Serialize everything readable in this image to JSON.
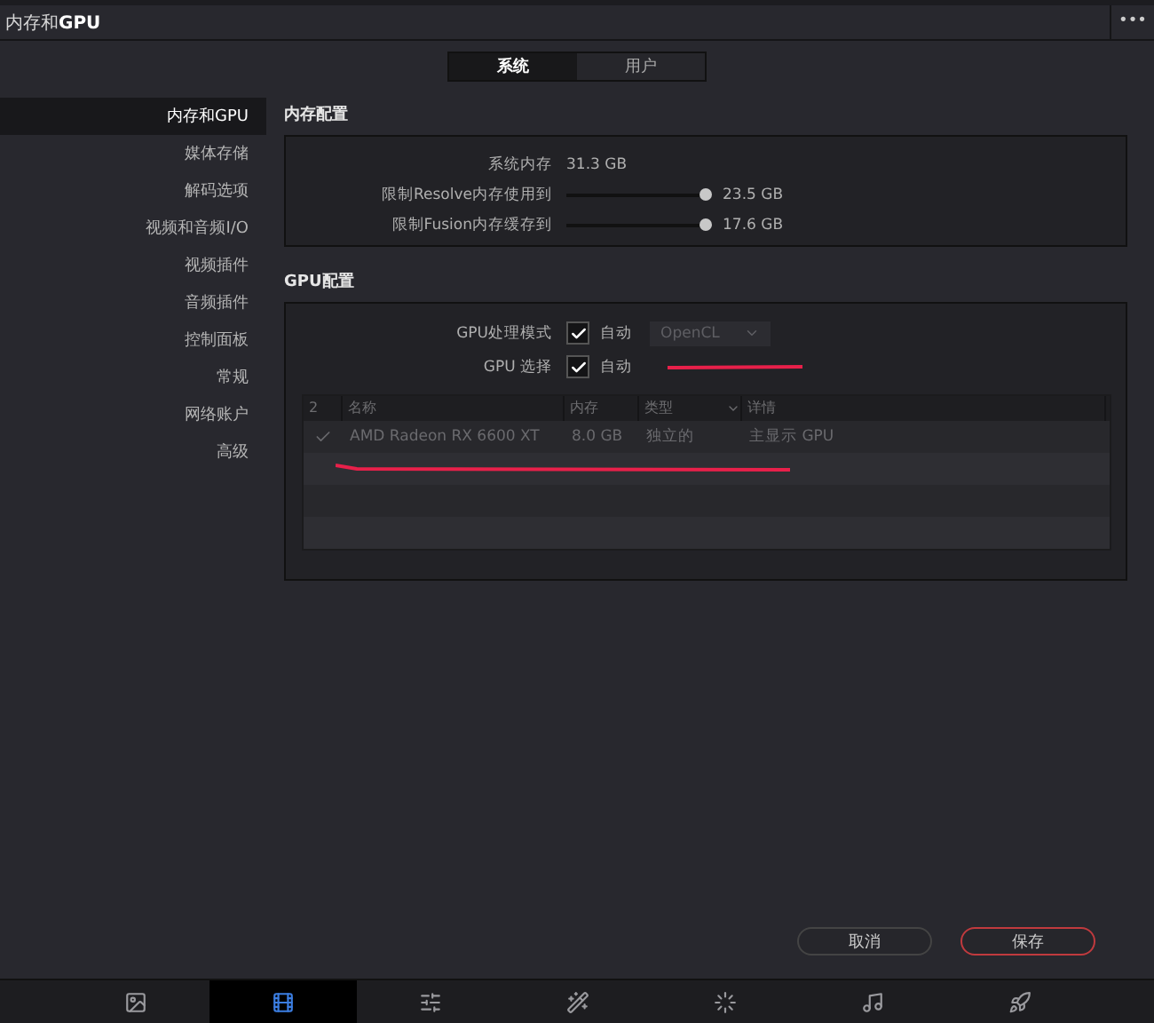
{
  "window": {
    "title": "内存和**GPU**",
    "menu": "•••"
  },
  "tabs": [
    {
      "label": "系统",
      "selected": true
    },
    {
      "label": "用户",
      "selected": false
    }
  ],
  "sidebar": {
    "items": [
      {
        "label": "内存和GPU",
        "selected": true
      },
      {
        "label": "媒体存储",
        "selected": false
      },
      {
        "label": "解码选项",
        "selected": false
      },
      {
        "label": "视频和音频I/O",
        "selected": false
      },
      {
        "label": "视频插件",
        "selected": false
      },
      {
        "label": "音频插件",
        "selected": false
      },
      {
        "label": "控制面板",
        "selected": false
      },
      {
        "label": "常规",
        "selected": false
      },
      {
        "label": "网络账户",
        "selected": false
      },
      {
        "label": "高级",
        "selected": false
      }
    ]
  },
  "memory": {
    "title": "内存配置",
    "system_label": "系统内存",
    "system_value": "31.3 GB",
    "sliders": [
      {
        "label": "限制Resolve内存使用到",
        "level": 1,
        "reading": "23.5 GB"
      },
      {
        "label": "限制Fusion内存缓存到",
        "level": 1,
        "reading": "17.6 GB"
      }
    ]
  },
  "gpu": {
    "title": "GPU配置",
    "options": [
      {
        "label": "GPU处理模式",
        "checked": true,
        "check_label": "自动",
        "dropdown": "OpenCL"
      },
      {
        "label": "GPU 选择",
        "checked": true,
        "check_label": "自动"
      }
    ],
    "table": {
      "select_header": "2",
      "columns": [
        "名称",
        "内存",
        "类型",
        "详情"
      ],
      "rows": [
        {
          "checked": true,
          "cells": [
            "AMD Radeon RX 6600 XT",
            "8.0 GB",
            "独立的",
            "主显示 GPU"
          ]
        }
      ]
    }
  },
  "buttons": [
    {
      "label": "取消",
      "kind": "secondary"
    },
    {
      "label": "保存",
      "kind": "primary"
    }
  ],
  "pages": [
    {
      "selected": false
    },
    {
      "selected": true
    },
    {
      "selected": false
    },
    {
      "selected": false
    },
    {
      "selected": false
    },
    {
      "selected": false
    },
    {
      "selected": false
    }
  ]
}
